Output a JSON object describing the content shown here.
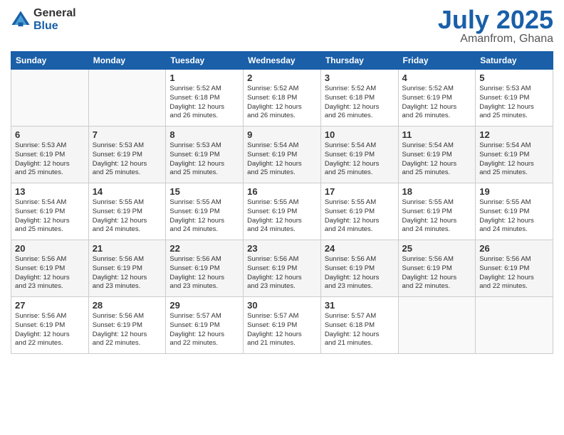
{
  "logo": {
    "general": "General",
    "blue": "Blue"
  },
  "title": {
    "month": "July 2025",
    "location": "Amanfrom, Ghana"
  },
  "days_of_week": [
    "Sunday",
    "Monday",
    "Tuesday",
    "Wednesday",
    "Thursday",
    "Friday",
    "Saturday"
  ],
  "weeks": [
    [
      {
        "day": "",
        "info": ""
      },
      {
        "day": "",
        "info": ""
      },
      {
        "day": "1",
        "info": "Sunrise: 5:52 AM\nSunset: 6:18 PM\nDaylight: 12 hours\nand 26 minutes."
      },
      {
        "day": "2",
        "info": "Sunrise: 5:52 AM\nSunset: 6:18 PM\nDaylight: 12 hours\nand 26 minutes."
      },
      {
        "day": "3",
        "info": "Sunrise: 5:52 AM\nSunset: 6:18 PM\nDaylight: 12 hours\nand 26 minutes."
      },
      {
        "day": "4",
        "info": "Sunrise: 5:52 AM\nSunset: 6:19 PM\nDaylight: 12 hours\nand 26 minutes."
      },
      {
        "day": "5",
        "info": "Sunrise: 5:53 AM\nSunset: 6:19 PM\nDaylight: 12 hours\nand 25 minutes."
      }
    ],
    [
      {
        "day": "6",
        "info": "Sunrise: 5:53 AM\nSunset: 6:19 PM\nDaylight: 12 hours\nand 25 minutes."
      },
      {
        "day": "7",
        "info": "Sunrise: 5:53 AM\nSunset: 6:19 PM\nDaylight: 12 hours\nand 25 minutes."
      },
      {
        "day": "8",
        "info": "Sunrise: 5:53 AM\nSunset: 6:19 PM\nDaylight: 12 hours\nand 25 minutes."
      },
      {
        "day": "9",
        "info": "Sunrise: 5:54 AM\nSunset: 6:19 PM\nDaylight: 12 hours\nand 25 minutes."
      },
      {
        "day": "10",
        "info": "Sunrise: 5:54 AM\nSunset: 6:19 PM\nDaylight: 12 hours\nand 25 minutes."
      },
      {
        "day": "11",
        "info": "Sunrise: 5:54 AM\nSunset: 6:19 PM\nDaylight: 12 hours\nand 25 minutes."
      },
      {
        "day": "12",
        "info": "Sunrise: 5:54 AM\nSunset: 6:19 PM\nDaylight: 12 hours\nand 25 minutes."
      }
    ],
    [
      {
        "day": "13",
        "info": "Sunrise: 5:54 AM\nSunset: 6:19 PM\nDaylight: 12 hours\nand 25 minutes."
      },
      {
        "day": "14",
        "info": "Sunrise: 5:55 AM\nSunset: 6:19 PM\nDaylight: 12 hours\nand 24 minutes."
      },
      {
        "day": "15",
        "info": "Sunrise: 5:55 AM\nSunset: 6:19 PM\nDaylight: 12 hours\nand 24 minutes."
      },
      {
        "day": "16",
        "info": "Sunrise: 5:55 AM\nSunset: 6:19 PM\nDaylight: 12 hours\nand 24 minutes."
      },
      {
        "day": "17",
        "info": "Sunrise: 5:55 AM\nSunset: 6:19 PM\nDaylight: 12 hours\nand 24 minutes."
      },
      {
        "day": "18",
        "info": "Sunrise: 5:55 AM\nSunset: 6:19 PM\nDaylight: 12 hours\nand 24 minutes."
      },
      {
        "day": "19",
        "info": "Sunrise: 5:55 AM\nSunset: 6:19 PM\nDaylight: 12 hours\nand 24 minutes."
      }
    ],
    [
      {
        "day": "20",
        "info": "Sunrise: 5:56 AM\nSunset: 6:19 PM\nDaylight: 12 hours\nand 23 minutes."
      },
      {
        "day": "21",
        "info": "Sunrise: 5:56 AM\nSunset: 6:19 PM\nDaylight: 12 hours\nand 23 minutes."
      },
      {
        "day": "22",
        "info": "Sunrise: 5:56 AM\nSunset: 6:19 PM\nDaylight: 12 hours\nand 23 minutes."
      },
      {
        "day": "23",
        "info": "Sunrise: 5:56 AM\nSunset: 6:19 PM\nDaylight: 12 hours\nand 23 minutes."
      },
      {
        "day": "24",
        "info": "Sunrise: 5:56 AM\nSunset: 6:19 PM\nDaylight: 12 hours\nand 23 minutes."
      },
      {
        "day": "25",
        "info": "Sunrise: 5:56 AM\nSunset: 6:19 PM\nDaylight: 12 hours\nand 22 minutes."
      },
      {
        "day": "26",
        "info": "Sunrise: 5:56 AM\nSunset: 6:19 PM\nDaylight: 12 hours\nand 22 minutes."
      }
    ],
    [
      {
        "day": "27",
        "info": "Sunrise: 5:56 AM\nSunset: 6:19 PM\nDaylight: 12 hours\nand 22 minutes."
      },
      {
        "day": "28",
        "info": "Sunrise: 5:56 AM\nSunset: 6:19 PM\nDaylight: 12 hours\nand 22 minutes."
      },
      {
        "day": "29",
        "info": "Sunrise: 5:57 AM\nSunset: 6:19 PM\nDaylight: 12 hours\nand 22 minutes."
      },
      {
        "day": "30",
        "info": "Sunrise: 5:57 AM\nSunset: 6:19 PM\nDaylight: 12 hours\nand 21 minutes."
      },
      {
        "day": "31",
        "info": "Sunrise: 5:57 AM\nSunset: 6:18 PM\nDaylight: 12 hours\nand 21 minutes."
      },
      {
        "day": "",
        "info": ""
      },
      {
        "day": "",
        "info": ""
      }
    ]
  ]
}
